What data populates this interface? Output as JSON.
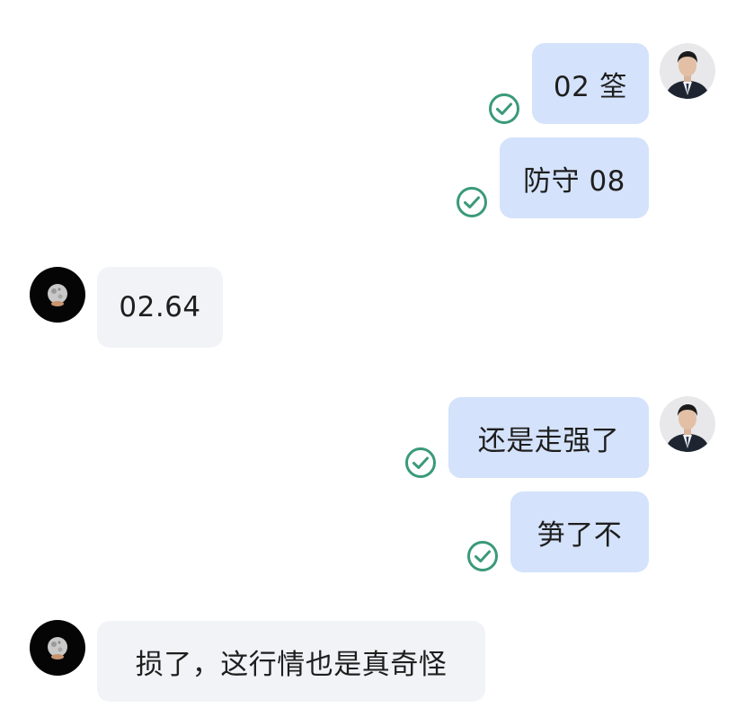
{
  "messages": [
    {
      "id": "m1",
      "side": "sent",
      "text": "02 筌",
      "status": "read"
    },
    {
      "id": "m2",
      "side": "sent",
      "text": "防守 08",
      "status": "read"
    },
    {
      "id": "m3",
      "side": "received",
      "text": "02.64"
    },
    {
      "id": "m4",
      "side": "sent",
      "text": "还是走强了",
      "status": "read"
    },
    {
      "id": "m5",
      "side": "sent",
      "text": "笋了不",
      "status": "read"
    },
    {
      "id": "m6",
      "side": "received",
      "text": "损了，这行情也是真奇怪"
    }
  ],
  "colors": {
    "sent_bubble": "#d4e2fb",
    "received_bubble": "#f1f3f6",
    "read_check": "#3a9a78",
    "text": "#1e1e1e"
  },
  "icons": {
    "read_status": "check-circle-icon",
    "self_avatar": "user-photo-avatar",
    "contact_avatar": "moon-avatar"
  }
}
